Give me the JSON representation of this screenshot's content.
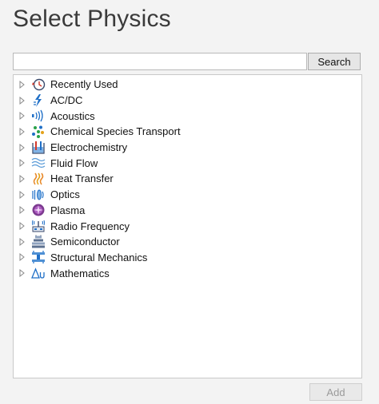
{
  "title": "Select Physics",
  "search": {
    "value": "",
    "placeholder": "",
    "button_label": "Search"
  },
  "tree": [
    {
      "label": "Recently Used",
      "icon": "clock-icon"
    },
    {
      "label": "AC/DC",
      "icon": "acdc-icon"
    },
    {
      "label": "Acoustics",
      "icon": "acoustics-icon"
    },
    {
      "label": "Chemical Species Transport",
      "icon": "chemical-species-icon"
    },
    {
      "label": "Electrochemistry",
      "icon": "electrochemistry-icon"
    },
    {
      "label": "Fluid Flow",
      "icon": "fluid-flow-icon"
    },
    {
      "label": "Heat Transfer",
      "icon": "heat-transfer-icon"
    },
    {
      "label": "Optics",
      "icon": "optics-icon"
    },
    {
      "label": "Plasma",
      "icon": "plasma-icon"
    },
    {
      "label": "Radio Frequency",
      "icon": "radio-frequency-icon"
    },
    {
      "label": "Semiconductor",
      "icon": "semiconductor-icon"
    },
    {
      "label": "Structural Mechanics",
      "icon": "structural-mechanics-icon"
    },
    {
      "label": "Mathematics",
      "icon": "mathematics-icon"
    }
  ],
  "add_label": "Add",
  "colors": {
    "background": "#f3f3f3",
    "panel": "#ffffff",
    "border": "#c9c9c9",
    "accent_blue": "#1f6fc7"
  }
}
